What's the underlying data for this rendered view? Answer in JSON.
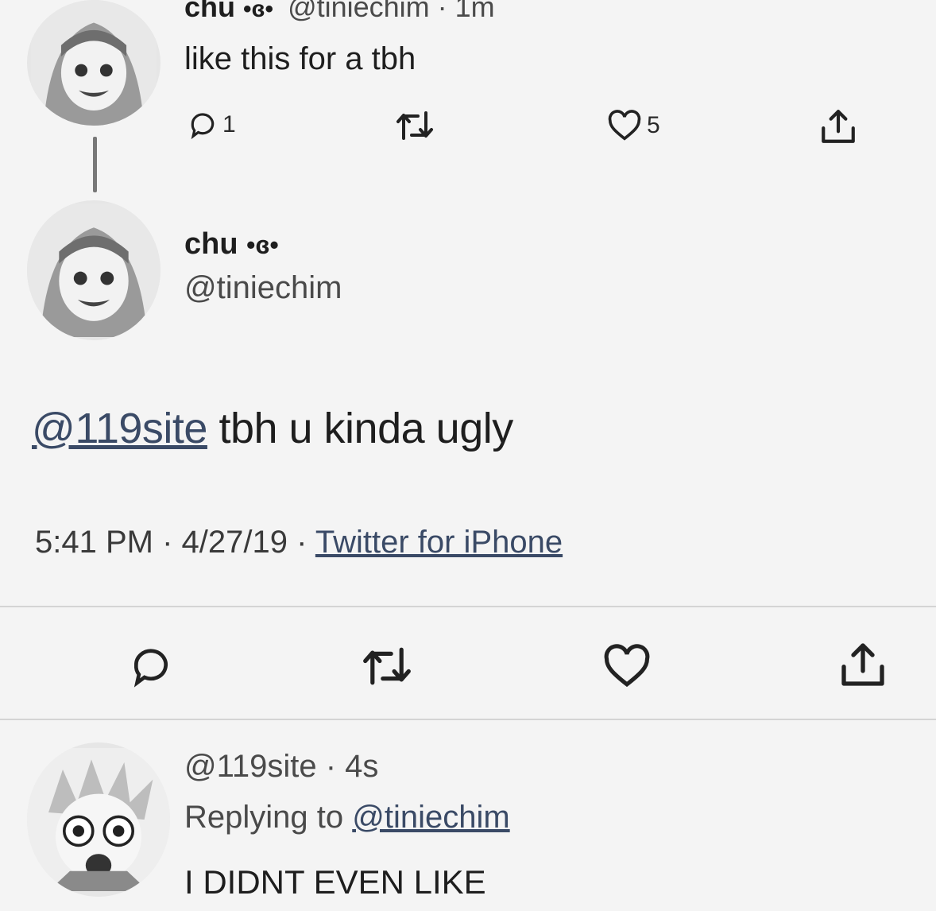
{
  "parent_tweet": {
    "display_name": "chu",
    "name_emoji": "•ɞ•",
    "handle_time": "@tiniechim · 1m",
    "text": "like this for a tbh",
    "reply_count": "1",
    "like_count": "5"
  },
  "main_tweet": {
    "display_name": "chu",
    "name_emoji": "•ɞ•",
    "handle": "@tiniechim",
    "mention": "@119site",
    "text": " tbh u kinda ugly",
    "time": "5:41 PM",
    "date": "4/27/19",
    "separator": "·",
    "source": "Twitter for iPhone"
  },
  "reply_tweet": {
    "handle_time": "@119site · 4s",
    "replying_prefix": "Replying to ",
    "replying_handle": "@tiniechim",
    "text": "I DIDNT EVEN LIKE"
  },
  "icons": {
    "reply": "reply-icon",
    "retweet": "retweet-icon",
    "like": "heart-icon",
    "share": "share-icon"
  },
  "colors": {
    "background": "#f4f4f4",
    "text": "#1e1e1e",
    "link": "#3a4a66",
    "divider": "#d4d4d4"
  }
}
